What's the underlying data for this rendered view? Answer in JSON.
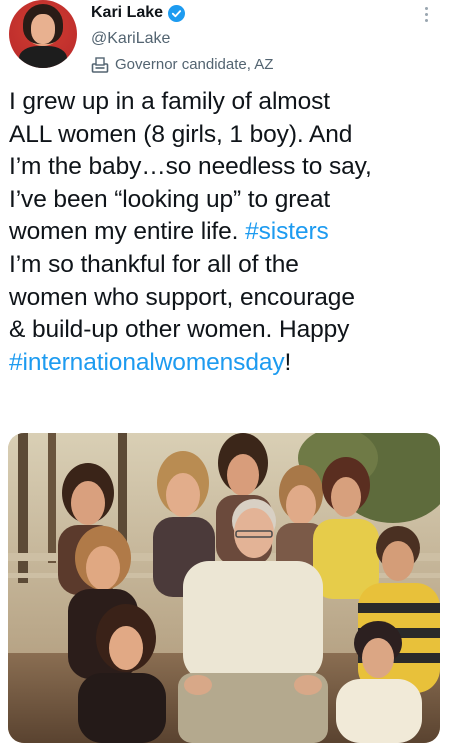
{
  "author": {
    "name": "Kari Lake",
    "handle": "@KariLake",
    "label": "Governor candidate, AZ",
    "verified": true
  },
  "tweet": {
    "lines": [
      [
        {
          "text": "I grew up in a family of almost"
        }
      ],
      [
        {
          "text": "ALL women (8 girls, 1 boy). And"
        }
      ],
      [
        {
          "text": "I’m the baby…so needless to say,"
        }
      ],
      [
        {
          "text": "I’ve been “looking up” to great"
        }
      ],
      [
        {
          "text": "women my entire life. "
        },
        {
          "text": "#sisters",
          "hashtag": true
        }
      ],
      [
        {
          "text": "I’m so thankful for all of the"
        }
      ],
      [
        {
          "text": "women who support, encourage"
        }
      ],
      [
        {
          "text": "& build-up other women. Happy"
        }
      ],
      [
        {
          "text": "#internationalwomensday",
          "hashtag": true
        },
        {
          "text": "!"
        }
      ]
    ]
  },
  "colors": {
    "hashtag": "#1d9bf0",
    "verified": "#1d9bf0",
    "secondary_text": "#536471"
  },
  "icons": {
    "verified": "verified-badge-icon",
    "label": "ballot-box-icon",
    "more": "more-options-icon"
  },
  "media": {
    "type": "photo",
    "subject": "family-group-photo"
  }
}
